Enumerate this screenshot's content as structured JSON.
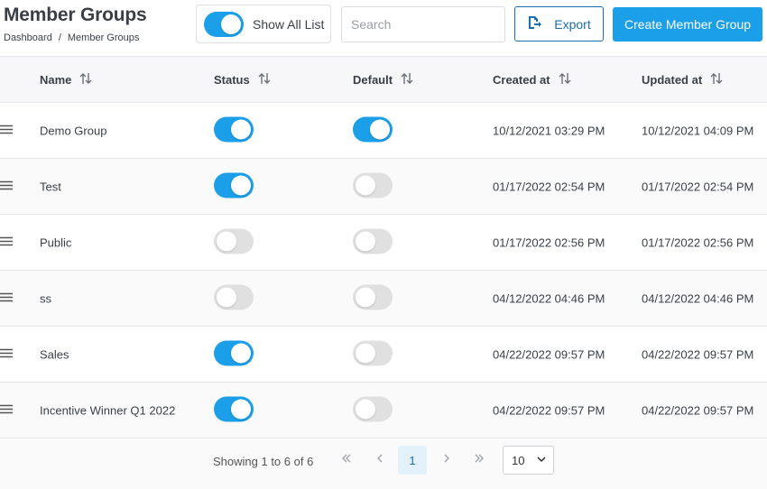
{
  "header": {
    "title": "Member Groups",
    "breadcrumb": [
      "Dashboard",
      "Member Groups"
    ],
    "breadcrumb_sep": "/"
  },
  "toolbar": {
    "show_all_label": "Show All List",
    "show_all_on": true,
    "search_placeholder": "Search",
    "search_value": "",
    "export_label": "Export",
    "create_label": "Create Member Group"
  },
  "table": {
    "columns": [
      "Name",
      "Status",
      "Default",
      "Created at",
      "Updated at"
    ],
    "rows": [
      {
        "name": "Demo Group",
        "status": true,
        "default": true,
        "created": "10/12/2021 03:29 PM",
        "updated": "10/12/2021 04:09 PM"
      },
      {
        "name": "Test",
        "status": true,
        "default": false,
        "created": "01/17/2022 02:54 PM",
        "updated": "01/17/2022 02:54 PM"
      },
      {
        "name": "Public",
        "status": false,
        "default": false,
        "created": "01/17/2022 02:56 PM",
        "updated": "01/17/2022 02:56 PM"
      },
      {
        "name": "ss",
        "status": false,
        "default": false,
        "created": "04/12/2022 04:46 PM",
        "updated": "04/12/2022 04:46 PM"
      },
      {
        "name": "Sales",
        "status": true,
        "default": false,
        "created": "04/22/2022 09:57 PM",
        "updated": "04/22/2022 09:57 PM"
      },
      {
        "name": "Incentive Winner Q1 2022",
        "status": true,
        "default": false,
        "created": "04/22/2022 09:57 PM",
        "updated": "04/22/2022 09:57 PM"
      }
    ]
  },
  "pagination": {
    "showing": "Showing 1 to 6 of 6",
    "current_page": "1",
    "per_page": "10"
  },
  "colors": {
    "accent": "#1b9fe8",
    "export_border": "#1b6fae",
    "toggle_off": "#e0e0e0"
  },
  "icons": {
    "sort": "sort-arrows-icon",
    "drag": "drag-handle-icon",
    "export": "export-icon",
    "first": "double-chevron-left-icon",
    "prev": "chevron-left-icon",
    "next": "chevron-right-icon",
    "last": "double-chevron-right-icon",
    "dropdown": "chevron-down-icon"
  }
}
